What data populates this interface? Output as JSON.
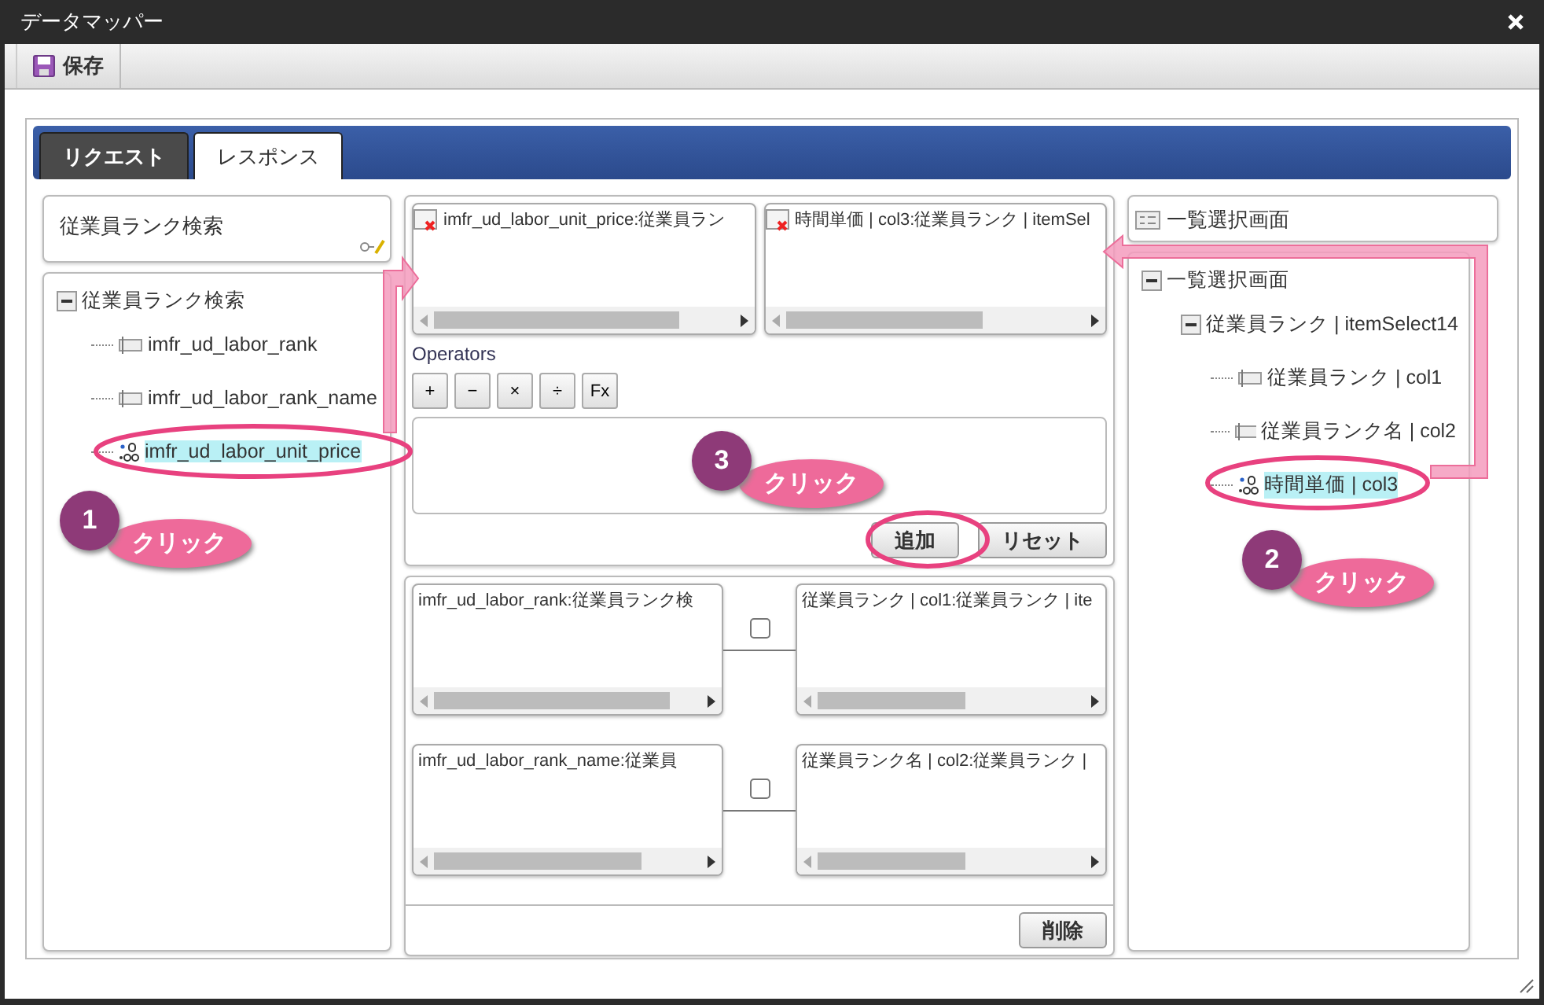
{
  "window": {
    "title": "データマッパー"
  },
  "toolbar": {
    "save": "保存"
  },
  "tabs": [
    {
      "label": "リクエスト",
      "selected": false
    },
    {
      "label": "レスポンス",
      "selected": true
    }
  ],
  "source": {
    "title": "従業員ランク検索",
    "tree": {
      "label": "従業員ランク検索",
      "expanded": true,
      "children": [
        {
          "label": "imfr_ud_labor_rank",
          "kind": "text",
          "selected": false
        },
        {
          "label": "imfr_ud_labor_rank_name",
          "kind": "text",
          "selected": false
        },
        {
          "label": "imfr_ud_labor_unit_price",
          "kind": "number",
          "selected": true
        }
      ]
    }
  },
  "mapping": {
    "source_field": "imfr_ud_labor_unit_price:従業員ラン",
    "target_field": "時間単価 | col3:従業員ランク | itemSel",
    "operators_label": "Operators",
    "operators": [
      "+",
      "−",
      "×",
      "÷",
      "Fx"
    ],
    "buttons": [
      "追加",
      "リセット"
    ]
  },
  "mappings": [
    {
      "source": "imfr_ud_labor_rank:従業員ランク検",
      "target": "従業員ランク | col1:従業員ランク | ite",
      "checked": false
    },
    {
      "source": "imfr_ud_labor_rank_name:従業員",
      "target": "従業員ランク名 | col2:従業員ランク |",
      "checked": false
    }
  ],
  "delete": "削除",
  "target": {
    "title": "一覧選択画面",
    "tree": {
      "label": "一覧選択画面",
      "expanded": true,
      "children": [
        {
          "label": "従業員ランク | itemSelect14",
          "expanded": true,
          "selected": false,
          "children": [
            {
              "label": "従業員ランク | col1",
              "kind": "text",
              "selected": false
            },
            {
              "label": "従業員ランク名 | col2",
              "kind": "text",
              "selected": false
            },
            {
              "label": "時間単価 | col3",
              "kind": "number",
              "selected": true
            }
          ]
        }
      ]
    }
  },
  "annotations": [
    {
      "number": "1",
      "label": "クリック"
    },
    {
      "number": "2",
      "label": "クリック"
    },
    {
      "number": "3",
      "label": "クリック"
    }
  ]
}
